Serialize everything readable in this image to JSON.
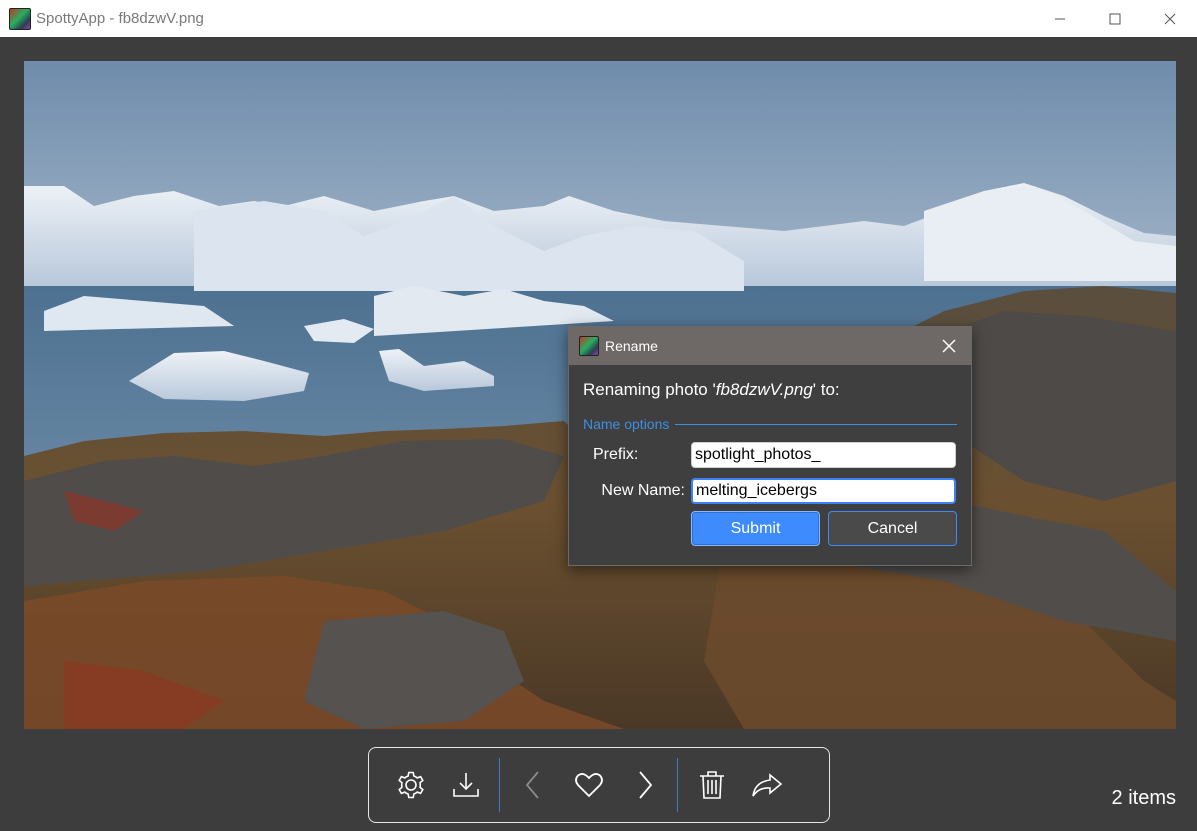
{
  "window": {
    "title": "SpottyApp - fb8dzwV.png",
    "minimize_icon": "minimize-icon",
    "maximize_icon": "maximize-icon",
    "close_icon": "close-icon"
  },
  "dialog": {
    "title": "Rename",
    "message_prefix": "Renaming photo '",
    "filename": "fb8dzwV.png",
    "message_suffix": "' to:",
    "group_label": "Name options",
    "prefix_label": "Prefix:",
    "prefix_value": "spotlight_photos_",
    "new_name_label": "New Name:",
    "new_name_value": "melting_icebergs",
    "submit_label": "Submit",
    "cancel_label": "Cancel"
  },
  "toolbar": {
    "buttons": [
      "gear-icon",
      "download-icon",
      "chevron-left-icon",
      "heart-icon",
      "chevron-right-icon",
      "trash-icon",
      "share-icon"
    ]
  },
  "status": {
    "items_count": "2 items"
  },
  "colors": {
    "accent": "#3d8bfd",
    "background": "#3d3d3d",
    "dialog_title_bg": "#6e6966"
  }
}
